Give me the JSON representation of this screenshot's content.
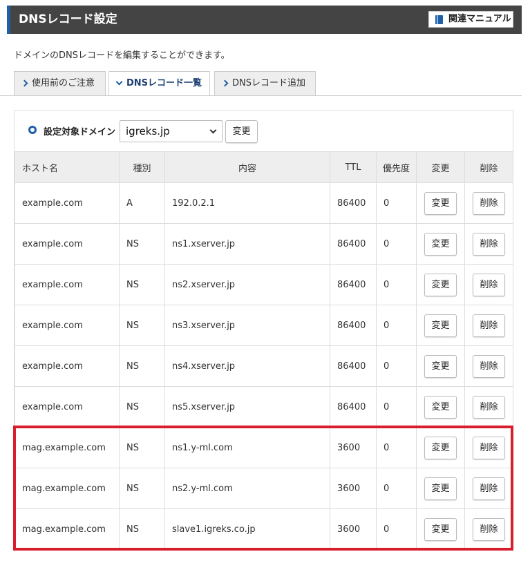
{
  "header": {
    "title": "DNSレコード設定",
    "manual_label": "関連マニュアル"
  },
  "description": "ドメインのDNSレコードを編集することができます。",
  "tabs": [
    {
      "label": "使用前のご注意",
      "active": false
    },
    {
      "label": "DNSレコード一覧",
      "active": true
    },
    {
      "label": "DNSレコード追加",
      "active": false
    }
  ],
  "domain": {
    "label": "設定対象ドメイン",
    "selected": "igreks.jp",
    "change_label": "変更"
  },
  "table": {
    "headers": [
      "ホスト名",
      "種別",
      "内容",
      "TTL",
      "優先度",
      "変更",
      "削除"
    ],
    "change_label": "変更",
    "delete_label": "削除",
    "rows": [
      {
        "host": "example.com",
        "type": "A",
        "content": "192.0.2.1",
        "ttl": "86400",
        "priority": "0"
      },
      {
        "host": "example.com",
        "type": "NS",
        "content": "ns1.xserver.jp",
        "ttl": "86400",
        "priority": "0"
      },
      {
        "host": "example.com",
        "type": "NS",
        "content": "ns2.xserver.jp",
        "ttl": "86400",
        "priority": "0"
      },
      {
        "host": "example.com",
        "type": "NS",
        "content": "ns3.xserver.jp",
        "ttl": "86400",
        "priority": "0"
      },
      {
        "host": "example.com",
        "type": "NS",
        "content": "ns4.xserver.jp",
        "ttl": "86400",
        "priority": "0"
      },
      {
        "host": "example.com",
        "type": "NS",
        "content": "ns5.xserver.jp",
        "ttl": "86400",
        "priority": "0"
      },
      {
        "host": "mag.example.com",
        "type": "NS",
        "content": "ns1.y-ml.com",
        "ttl": "3600",
        "priority": "0"
      },
      {
        "host": "mag.example.com",
        "type": "NS",
        "content": "ns2.y-ml.com",
        "ttl": "3600",
        "priority": "0"
      },
      {
        "host": "mag.example.com",
        "type": "NS",
        "content": "slave1.igreks.co.jp",
        "ttl": "3600",
        "priority": "0"
      }
    ]
  },
  "colors": {
    "header_bg": "#444444",
    "accent": "#1e5fa8",
    "highlight": "#d81e2c"
  }
}
